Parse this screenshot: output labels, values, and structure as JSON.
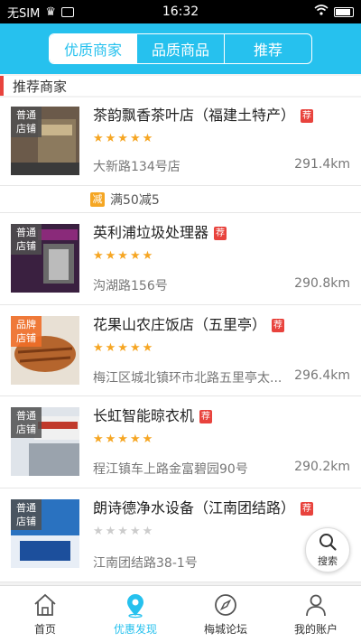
{
  "status_bar": {
    "carrier": "无SIM",
    "time": "16:32"
  },
  "segments": [
    {
      "label": "优质商家",
      "active": true
    },
    {
      "label": "品质商品",
      "active": false
    },
    {
      "label": "推荐",
      "active": false
    }
  ],
  "section_title": "推荐商家",
  "tag_label": "荐",
  "stores": [
    {
      "name": "茶韵飘香茶叶店（福建土特产）",
      "badge": "普通店铺",
      "badge_line1": "普通",
      "badge_line2": "店铺",
      "rating": 5,
      "address": "大新路134号店",
      "distance": "291.4km",
      "promo": "满50减5",
      "promo_icon": "减",
      "thumb_color": "#6b5a4a"
    },
    {
      "name": "英利浦垃圾处理器",
      "badge": "普通店铺",
      "badge_line1": "普通",
      "badge_line2": "店铺",
      "rating": 5,
      "address": "沟湖路156号",
      "distance": "290.8km",
      "thumb_color": "#7a2a6a"
    },
    {
      "name": "花果山农庄饭店（五里亭）",
      "badge": "品牌店铺",
      "badge_line1": "品牌",
      "badge_line2": "店铺",
      "rating": 5,
      "address": "梅江区城北镇环市北路五里亭太...",
      "distance": "296.4km",
      "thumb_color": "#b5652d"
    },
    {
      "name": "长虹智能晾衣机",
      "badge": "普通店铺",
      "badge_line1": "普通",
      "badge_line2": "店铺",
      "rating": 5,
      "address": "程江镇车上路金富碧园90号",
      "distance": "290.2km",
      "thumb_color": "#9aa3ad"
    },
    {
      "name": "朗诗德净水设备（江南团结路）",
      "badge": "普通店铺",
      "badge_line1": "普通",
      "badge_line2": "店铺",
      "rating": 0,
      "address": "江南团结路38-1号",
      "distance": "29",
      "thumb_color": "#2a72c0"
    }
  ],
  "search_fab": {
    "label": "搜索",
    "icon": "search-icon"
  },
  "tabbar": [
    {
      "label": "首页",
      "icon": "home-icon",
      "active": false
    },
    {
      "label": "优惠发现",
      "icon": "location-icon",
      "active": true
    },
    {
      "label": "梅城论坛",
      "icon": "compass-icon",
      "active": false
    },
    {
      "label": "我的账户",
      "icon": "user-icon",
      "active": false
    }
  ],
  "colors": {
    "primary": "#26c1ee",
    "accent": "#e8433d",
    "star": "#f6a623"
  }
}
